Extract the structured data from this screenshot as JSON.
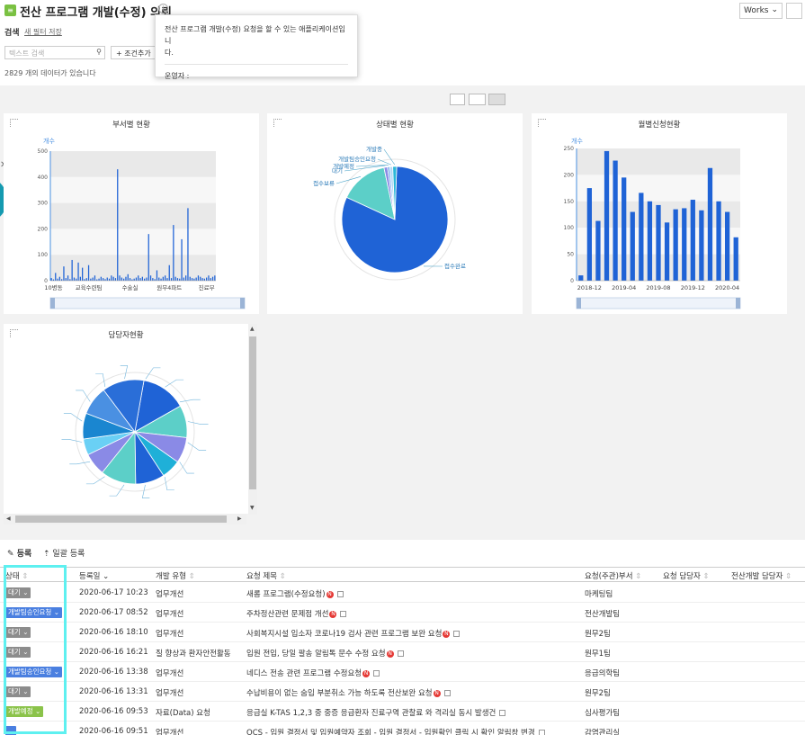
{
  "header": {
    "app_icon": "board-icon",
    "title": "전산 프로그램 개발(수정) 의뢰",
    "info_icon": "info-icon",
    "tooltip_line1": "전산 프로그램 개발(수정) 요청을 할 수 있는 애플리케이션입니",
    "tooltip_line2": "다.",
    "tooltip_owner": "운영자 :",
    "works_label": "Works"
  },
  "search": {
    "label": "검색",
    "save_filter": "새 필터 저장",
    "placeholder": "텍스트 검색",
    "add_condition": "+ 조건추가",
    "count_text": "2829 개의 데이터가 있습니다"
  },
  "charts_text": {
    "dept": {
      "title": "부서별 현황",
      "ylabel": "개수",
      "xticks": [
        "10병동",
        "교육수련팀",
        "수술실",
        "원무4파트",
        "진료부"
      ],
      "yticks": [
        "0",
        "100",
        "200",
        "300",
        "400",
        "500"
      ]
    },
    "status": {
      "title": "상태별 현황"
    },
    "monthly": {
      "title": "월별신청현황",
      "ylabel": "개수",
      "xticks": [
        "2018-12",
        "2019-04",
        "2019-08",
        "2019-12",
        "2020-04"
      ],
      "yticks": [
        "0",
        "50",
        "100",
        "150",
        "200",
        "250"
      ]
    },
    "manager": {
      "title": "담당자현황"
    }
  },
  "chart_data": [
    {
      "type": "bar",
      "title": "부서별 현황",
      "ylabel": "개수",
      "ylim": [
        0,
        500
      ],
      "tick_labels": [
        "10병동",
        "교육수련팀",
        "수술실",
        "원무4파트",
        "진료부"
      ],
      "values": [
        10,
        5,
        30,
        8,
        15,
        6,
        55,
        10,
        20,
        6,
        80,
        12,
        8,
        70,
        15,
        50,
        6,
        10,
        60,
        8,
        12,
        20,
        5,
        8,
        15,
        10,
        6,
        12,
        8,
        20,
        15,
        10,
        430,
        20,
        12,
        8,
        15,
        25,
        10,
        5,
        8,
        12,
        20,
        10,
        15,
        8,
        12,
        180,
        20,
        10,
        6,
        40,
        12,
        8,
        15,
        20,
        10,
        60,
        10,
        215,
        15,
        10,
        8,
        160,
        12,
        20,
        280,
        15,
        10,
        8,
        12,
        20,
        15,
        10,
        8,
        12,
        20,
        10,
        15,
        20
      ]
    },
    {
      "type": "pie",
      "title": "상태별 현황",
      "labels": [
        "접수완료",
        "접수보류",
        "대기",
        "개발예정",
        "개발팀승인요청",
        "개발중"
      ],
      "values": [
        2300,
        420,
        30,
        20,
        25,
        34
      ]
    },
    {
      "type": "bar",
      "title": "월별신청현황",
      "ylabel": "개수",
      "ylim": [
        0,
        250
      ],
      "x": [
        "2018-11",
        "2018-12",
        "2019-01",
        "2019-02",
        "2019-03",
        "2019-04",
        "2019-05",
        "2019-06",
        "2019-07",
        "2019-08",
        "2019-09",
        "2019-10",
        "2019-11",
        "2019-12",
        "2020-01",
        "2020-02",
        "2020-03",
        "2020-04",
        "2020-05"
      ],
      "tick_labels": [
        "2018-12",
        "2019-04",
        "2019-08",
        "2019-12",
        "2020-04"
      ],
      "values": [
        10,
        175,
        113,
        245,
        227,
        195,
        130,
        166,
        150,
        143,
        110,
        135,
        137,
        153,
        133,
        213,
        150,
        130,
        82
      ]
    },
    {
      "type": "pie",
      "title": "담당자현황",
      "labels": [],
      "values": [
        14,
        10,
        8,
        6,
        9,
        11,
        7,
        5,
        8,
        9,
        13
      ]
    }
  ],
  "list": {
    "register_label": "등록",
    "bulk_register_label": "일괄 등록",
    "columns": [
      "상태",
      "등록일",
      "개발 유형",
      "요청 제목",
      "요청(주관)부서",
      "요청 담당자",
      "전산개발 담당자"
    ],
    "rows": [
      {
        "status": "대기",
        "status_color": "#8c8c8c",
        "date": "2020-06-17 10:23",
        "type": "업무개선",
        "title": "새롬 프로그램(수정요청)",
        "new": true,
        "dept": "마케팅팀"
      },
      {
        "status": "개발팀승인요청",
        "status_color": "#4a7fe0",
        "date": "2020-06-17 08:52",
        "type": "업무개선",
        "title": "주차정산관련 문제점 개선",
        "new": true,
        "dept": "전산개발팀"
      },
      {
        "status": "대기",
        "status_color": "#8c8c8c",
        "date": "2020-06-16 18:10",
        "type": "업무개선",
        "title": "사회복지시설 입소자 코로나19 검사 관련 프로그램 보완 요청",
        "new": true,
        "dept": "원무2팀"
      },
      {
        "status": "대기",
        "status_color": "#8c8c8c",
        "date": "2020-06-16 16:21",
        "type": "질 향상과 환자안전활동",
        "title": "입원 전입, 당일 팔송 알림톡 문수 수정 요청",
        "new": true,
        "dept": "원무1팀"
      },
      {
        "status": "개발팀승인요청",
        "status_color": "#4a7fe0",
        "date": "2020-06-16 13:38",
        "type": "업무개선",
        "title": "네디스 전송 관련 프로그램 수정요청",
        "new": true,
        "dept": "응급의학팀"
      },
      {
        "status": "대기",
        "status_color": "#8c8c8c",
        "date": "2020-06-16 13:31",
        "type": "업무개선",
        "title": "수납비용이 없는 숨입 부분취소 가능 하도록 전산보완 요청",
        "new": true,
        "dept": "원무2팀"
      },
      {
        "status": "개발예정",
        "status_color": "#8bc34a",
        "date": "2020-06-16 09:53",
        "type": "자료(Data) 요청",
        "title": "응급실 K-TAS 1,2,3 중 중증 응급환자 진료구역 관찰료 와 격리실 동시 발생건",
        "new": false,
        "dept": "심사평가팀"
      },
      {
        "status": "",
        "status_color": "#4a7fe0",
        "date": "2020-06-16 09:51",
        "type": "업무개선",
        "title": "OCS - 입원 결정서 및 입원예약자 조회 - 입원 결정서 - 입원확인 클릭 시 확인 알림창 변경",
        "new": false,
        "dept": "감염관리실"
      }
    ]
  }
}
